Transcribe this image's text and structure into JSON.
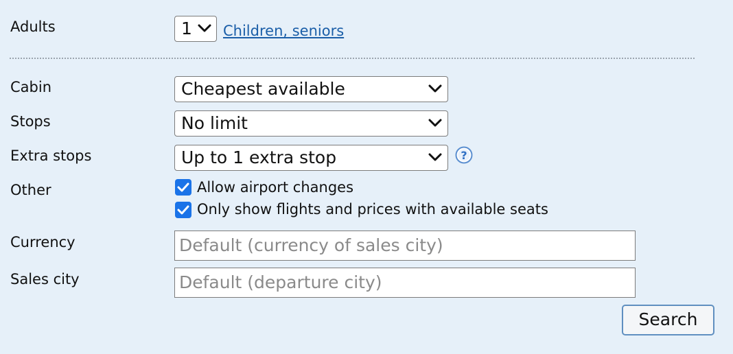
{
  "adults": {
    "label": "Adults",
    "value": "1",
    "link": "Children, seniors"
  },
  "cabin": {
    "label": "Cabin",
    "value": "Cheapest available"
  },
  "stops": {
    "label": "Stops",
    "value": "No limit"
  },
  "extra_stops": {
    "label": "Extra stops",
    "value": "Up to 1 extra stop",
    "help_icon": "question-circle-icon"
  },
  "other": {
    "label": "Other",
    "options": [
      {
        "label": "Allow airport changes",
        "checked": true
      },
      {
        "label": "Only show flights and prices with available seats",
        "checked": true
      }
    ]
  },
  "currency": {
    "label": "Currency",
    "placeholder": "Default (currency of sales city)"
  },
  "sales_city": {
    "label": "Sales city",
    "placeholder": "Default (departure city)"
  },
  "search_button": {
    "label": "Search"
  },
  "colors": {
    "background": "#e6f0f9",
    "link": "#1a5ea8",
    "checkbox": "#1a73e8",
    "button_border": "#5f8fc0"
  }
}
